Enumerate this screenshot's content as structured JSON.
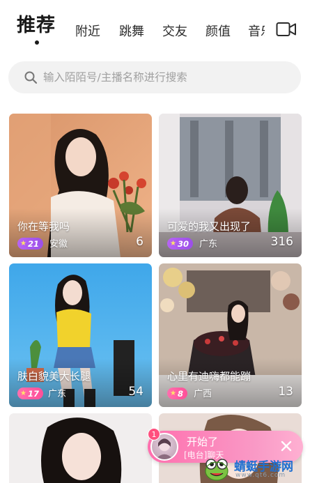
{
  "tabs": {
    "active": "推荐",
    "items": [
      "附近",
      "跳舞",
      "交友",
      "颜值",
      "音乐"
    ]
  },
  "search": {
    "placeholder": "输入陌陌号/主播名称进行搜索"
  },
  "cards": [
    {
      "title": "你在等我吗",
      "level": "21",
      "location": "安徽",
      "count": "6"
    },
    {
      "title": "可爱的我又出现了",
      "level": "30",
      "location": "广东",
      "count": "316"
    },
    {
      "title": "肤白貌美大长腿",
      "level": "17",
      "location": "广东",
      "count": "54"
    },
    {
      "title": "心里有迪嗨都能蹦",
      "level": "8",
      "location": "广西",
      "count": "13"
    }
  ],
  "notification": {
    "badge": "1",
    "title": "开始了",
    "subtitle": "[电台]聊天"
  },
  "watermark": {
    "name": "蜻蜓手游网",
    "url": "www.qt6.com"
  },
  "colors": {
    "accent_purple": "#9b4fe8",
    "accent_pink": "#ff4f98",
    "watermark_blue": "#1f6fd1"
  },
  "icons": [
    "video-camera-icon",
    "search-icon",
    "star-icon",
    "close-icon"
  ]
}
